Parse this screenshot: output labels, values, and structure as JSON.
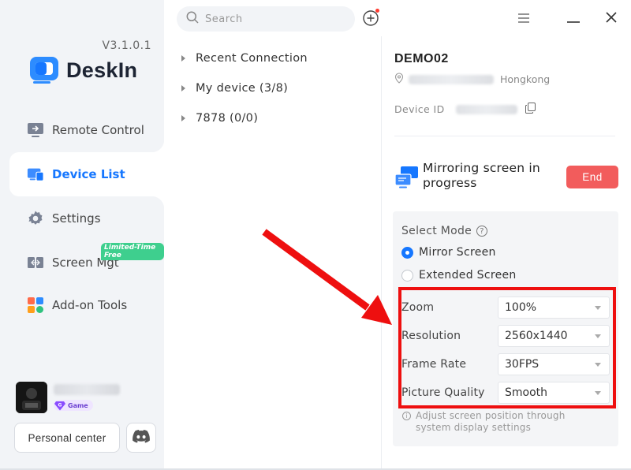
{
  "app": {
    "version": "V3.1.0.1",
    "brand": "DeskIn",
    "accent_color": "#1677ff"
  },
  "sidebar": {
    "items": [
      {
        "label": "Remote Control",
        "icon": "remote-control-icon"
      },
      {
        "label": "Device List",
        "icon": "device-list-icon",
        "active": true
      },
      {
        "label": "Settings",
        "icon": "gear-icon"
      },
      {
        "label": "Screen Mgt",
        "icon": "screen-mgt-icon",
        "badge": "Limited-Time Free"
      },
      {
        "label": "Add-on Tools",
        "icon": "add-on-tools-icon"
      }
    ],
    "user": {
      "badge": "Game",
      "badge_letter": "G"
    },
    "personal_center_label": "Personal center"
  },
  "topbar": {
    "search_placeholder": "Search",
    "add_icon": "plus-circle-icon",
    "menu_icon": "hamburger-icon",
    "minimize_icon": "minimize-icon",
    "close_icon": "close-icon"
  },
  "tree": {
    "items": [
      {
        "label": "Recent Connection"
      },
      {
        "label": "My device (3/8)"
      },
      {
        "label": "7878 (0/0)"
      }
    ]
  },
  "device": {
    "name": "DEMO02",
    "location": "Hongkong",
    "device_id_label": "Device ID",
    "status_text": "Mirroring screen in progress",
    "end_label": "End",
    "end_color": "#f25c5c"
  },
  "mode": {
    "title": "Select Mode",
    "options": [
      {
        "label": "Mirror Screen",
        "selected": true
      },
      {
        "label": "Extended Screen",
        "selected": false
      }
    ],
    "settings": [
      {
        "label": "Zoom",
        "value": "100%"
      },
      {
        "label": "Resolution",
        "value": "2560x1440"
      },
      {
        "label": "Frame Rate",
        "value": "30FPS"
      },
      {
        "label": "Picture Quality",
        "value": "Smooth"
      }
    ],
    "hint": "Adjust screen position through system display settings"
  },
  "annotation": {
    "color": "#ee0f0f"
  }
}
